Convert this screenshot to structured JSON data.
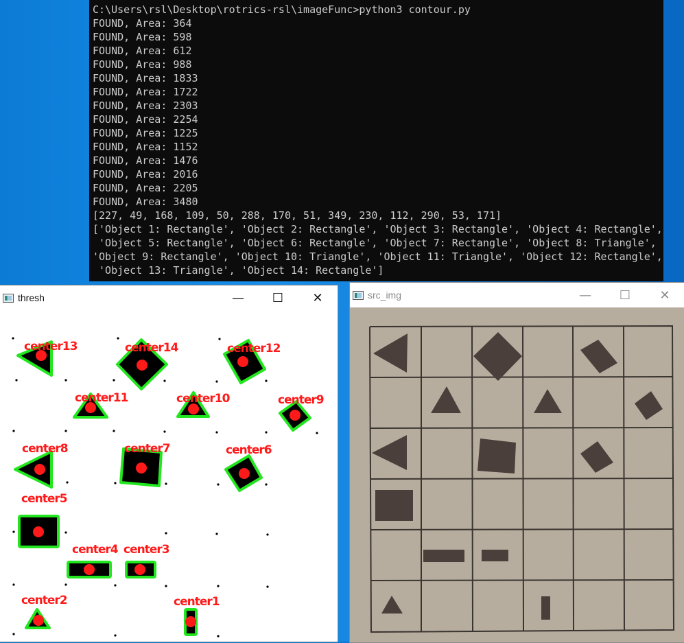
{
  "console": {
    "lines": [
      "C:\\Users\\rsl\\Desktop\\rotrics-rsl\\imageFunc>python3 contour.py",
      "FOUND, Area: 364",
      "FOUND, Area: 598",
      "FOUND, Area: 612",
      "FOUND, Area: 988",
      "FOUND, Area: 1833",
      "FOUND, Area: 1722",
      "FOUND, Area: 2303",
      "FOUND, Area: 2254",
      "FOUND, Area: 1225",
      "FOUND, Area: 1152",
      "FOUND, Area: 1476",
      "FOUND, Area: 2016",
      "FOUND, Area: 2205",
      "FOUND, Area: 3480",
      "[227, 49, 168, 109, 50, 288, 170, 51, 349, 230, 112, 290, 53, 171]",
      "['Object 1: Rectangle', 'Object 2: Rectangle', 'Object 3: Rectangle', 'Object 4: Rectangle',",
      " 'Object 5: Rectangle', 'Object 6: Rectangle', 'Object 7: Rectangle', 'Object 8: Triangle',",
      "'Object 9: Rectangle', 'Object 10: Triangle', 'Object 11: Triangle', 'Object 12: Rectangle',",
      " 'Object 13: Triangle', 'Object 14: Rectangle']"
    ]
  },
  "thresh_window": {
    "title": "thresh",
    "minimize": "—",
    "maximize": "☐",
    "close": "✕",
    "labels": {
      "c13": "center13",
      "c14": "center14",
      "c12": "center12",
      "c11": "center11",
      "c10": "center10",
      "c9": "center9",
      "c8": "center8",
      "c7": "center7",
      "c6": "center6",
      "c5": "center5",
      "c4": "center4",
      "c3": "center3",
      "c2": "center2",
      "c1": "center1"
    }
  },
  "src_window": {
    "title": "src_img",
    "minimize": "—",
    "maximize": "☐",
    "close": "✕"
  },
  "colors": {
    "console_bg": "#0c0c0c",
    "console_text": "#cccccc",
    "contour_green": "#22e61e",
    "center_red": "#ff1a1a",
    "paper": "#b7ad9f"
  }
}
